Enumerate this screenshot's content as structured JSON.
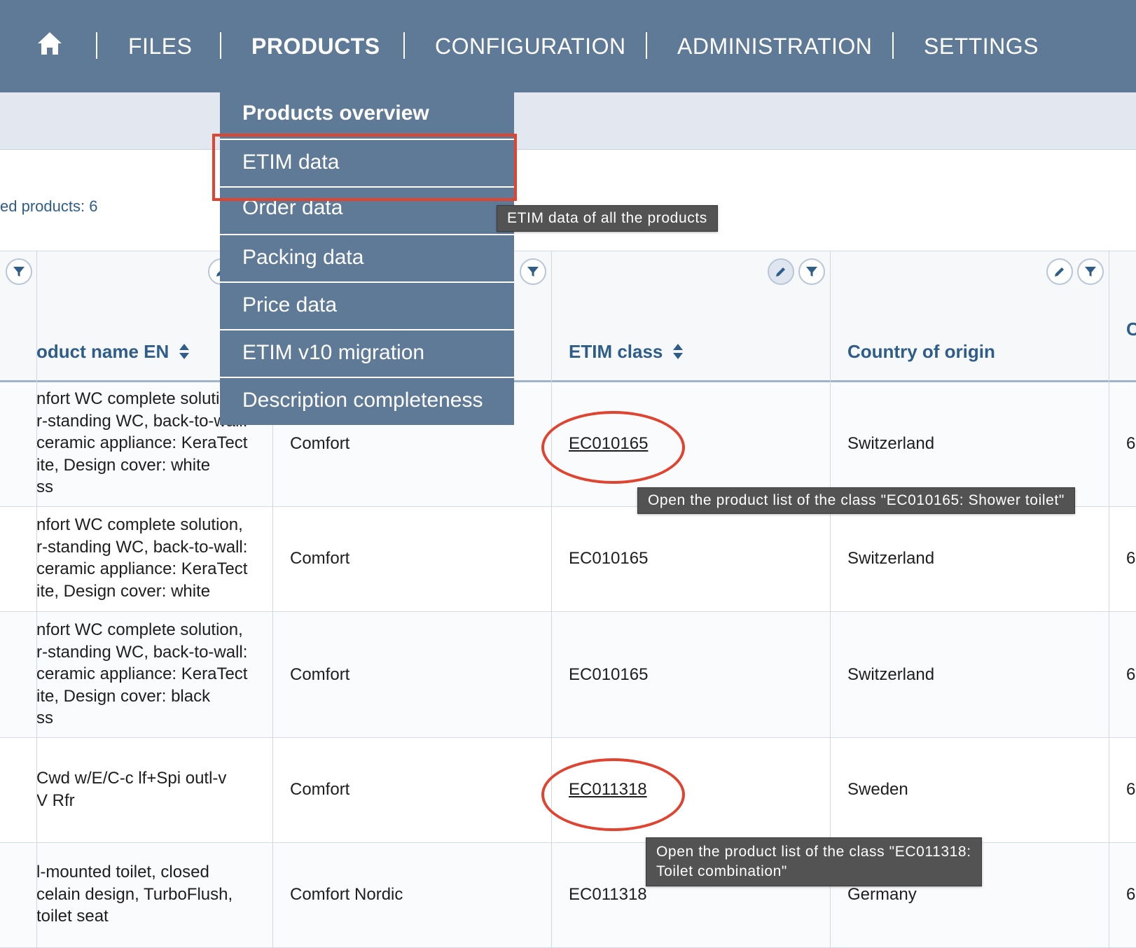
{
  "nav": {
    "items": [
      {
        "label": "FILES"
      },
      {
        "label": "PRODUCTS"
      },
      {
        "label": "CONFIGURATION"
      },
      {
        "label": "ADMINISTRATION"
      },
      {
        "label": "SETTINGS"
      }
    ],
    "active": "PRODUCTS",
    "icons": {
      "home": "home-icon"
    }
  },
  "info": {
    "text": "ed products: 6"
  },
  "dropdown": {
    "items": [
      {
        "label": "Products overview"
      },
      {
        "label": "ETIM data"
      },
      {
        "label": "Order data"
      },
      {
        "label": "Packing data"
      },
      {
        "label": "Price data"
      },
      {
        "label": "ETIM v10 migration"
      },
      {
        "label": "Description completeness"
      }
    ],
    "highlighted": "ETIM data"
  },
  "table": {
    "headers": {
      "product_name": "oduct name EN",
      "etim_class": "ETIM class",
      "country": "Country of origin",
      "next": "C"
    },
    "rows": [
      {
        "name_lines": [
          "nfort WC complete solution,",
          "r-standing WC, back-to-wall:",
          " ceramic appliance: KeraTect",
          "ite, Design cover: white",
          "ss"
        ],
        "series": "Comfort",
        "etim": "EC010165",
        "country": "Switzerland",
        "next": "6"
      },
      {
        "name_lines": [
          "nfort WC complete solution,",
          "r-standing WC, back-to-wall:",
          " ceramic appliance: KeraTect",
          "ite, Design cover: white"
        ],
        "series": "Comfort",
        "etim": "EC010165",
        "country": "Switzerland",
        "next": "6"
      },
      {
        "name_lines": [
          "nfort WC complete solution,",
          "r-standing WC, back-to-wall:",
          " ceramic appliance: KeraTect",
          "ite, Design cover: black",
          "ss"
        ],
        "series": "Comfort",
        "etim": "EC010165",
        "country": "Switzerland",
        "next": "6"
      },
      {
        "name_lines": [
          "Cwd w/E/C-c lf+Spi outl-v",
          "V Rfr"
        ],
        "series": "Comfort",
        "etim": "EC011318",
        "country": "Sweden",
        "next": "6"
      },
      {
        "name_lines": [
          "l-mounted toilet, closed",
          "celain design, TurboFlush,",
          " toilet seat"
        ],
        "series": "Comfort Nordic",
        "etim": "EC011318",
        "country": "Germany",
        "next": "6"
      }
    ]
  },
  "tooltips": {
    "etim_menu": "ETIM data of all the products",
    "class1": "Open the product list of the class \"EC010165: Shower toilet\"",
    "class2_line1": "Open the product list of the class \"EC011318:",
    "class2_line2": "Toilet combination\""
  },
  "colors": {
    "nav_bg": "#5f7a97",
    "header_text": "#2f5d8a",
    "highlight": "#e0432f",
    "tooltip_bg": "#535353"
  }
}
